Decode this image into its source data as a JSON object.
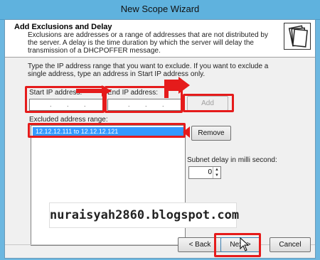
{
  "window": {
    "title": "New Scope Wizard"
  },
  "header": {
    "title": "Add Exclusions and Delay",
    "description": "Exclusions are addresses or a range of addresses that are not distributed by the server. A delay is the time duration by which the server will delay the transmission of a DHCPOFFER message.",
    "icon": "folders-icon"
  },
  "form": {
    "instruction": "Type the IP address range that you want to exclude. If you want to exclude a single address, type an address in Start IP address only.",
    "start_ip_label": "Start IP address:",
    "end_ip_label": "End IP address:",
    "start_ip_value": ". . .",
    "end_ip_value": ". . .",
    "add_label": "Add",
    "excluded_label": "Excluded address range:",
    "excluded_items": [
      "12.12.12.111 to 12.12.12.121"
    ],
    "remove_label": "Remove",
    "delay_label": "Subnet delay in milli second:",
    "delay_value": "0"
  },
  "watermark": "nuraisyah2860.blogspot.com",
  "footer": {
    "back_label": "< Back",
    "next_label": "Next >",
    "cancel_label": "Cancel"
  },
  "colors": {
    "highlight": "#e51b1b",
    "selection": "#3399ff"
  }
}
